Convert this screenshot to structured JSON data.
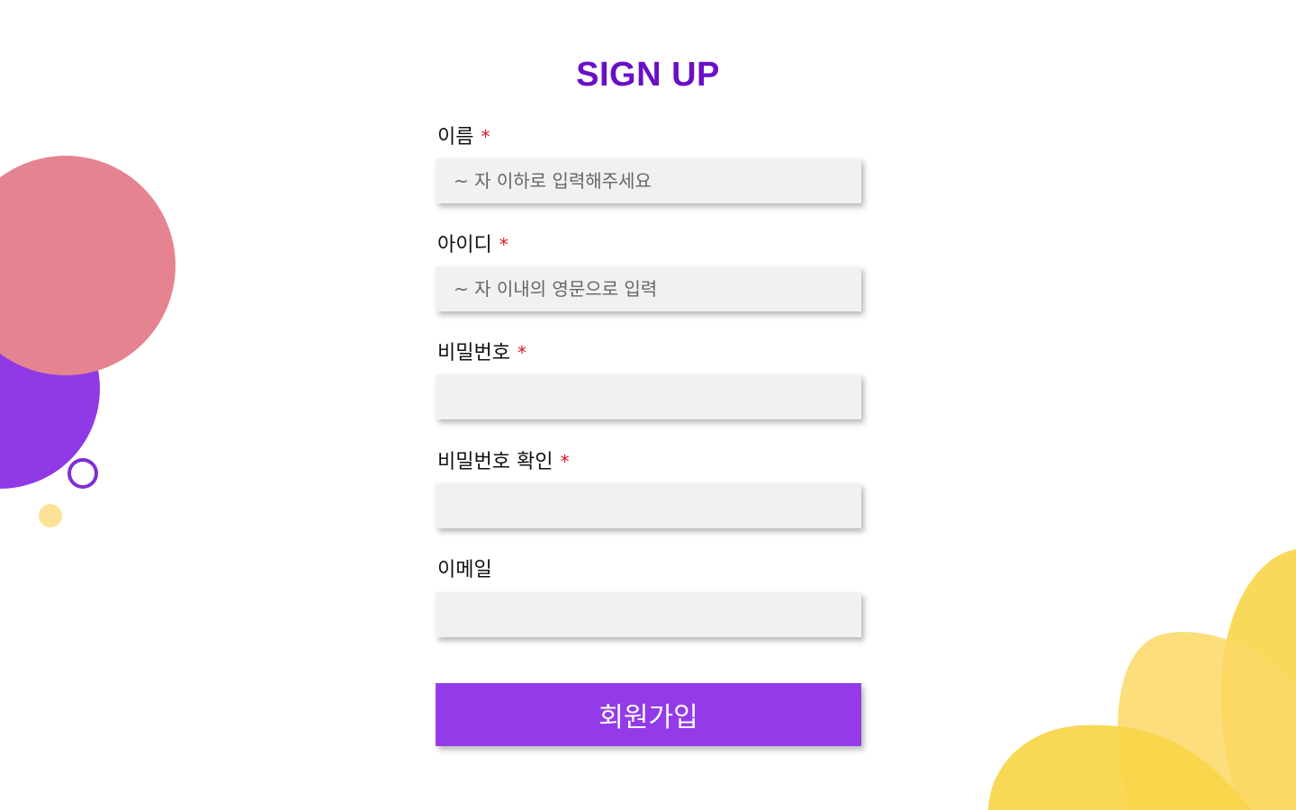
{
  "header": {
    "title": "SIGN UP"
  },
  "form": {
    "required_mark": "*",
    "fields": [
      {
        "label": "이름",
        "placeholder": "~ 자 이하로 입력해주세요",
        "value": "",
        "required": true
      },
      {
        "label": "아이디",
        "placeholder": "~ 자 이내의 영문으로 입력",
        "value": "",
        "required": true
      },
      {
        "label": "비밀번호",
        "placeholder": "",
        "value": "",
        "required": true
      },
      {
        "label": "비밀번호 확인",
        "placeholder": "",
        "value": "",
        "required": true
      },
      {
        "label": "이메일",
        "placeholder": "",
        "value": "",
        "required": false
      }
    ],
    "submit_label": "회원가입"
  },
  "colors": {
    "title": "#6a0fc7",
    "required": "#e0141e",
    "input_bg": "#f1f1f1",
    "button": "#933be8",
    "deco_pink": "#e68390",
    "deco_purple": "#8f3ae6",
    "deco_ring": "#7f2fd6",
    "deco_yellow": "#f9d548",
    "deco_yellow_light": "#fbe296"
  }
}
